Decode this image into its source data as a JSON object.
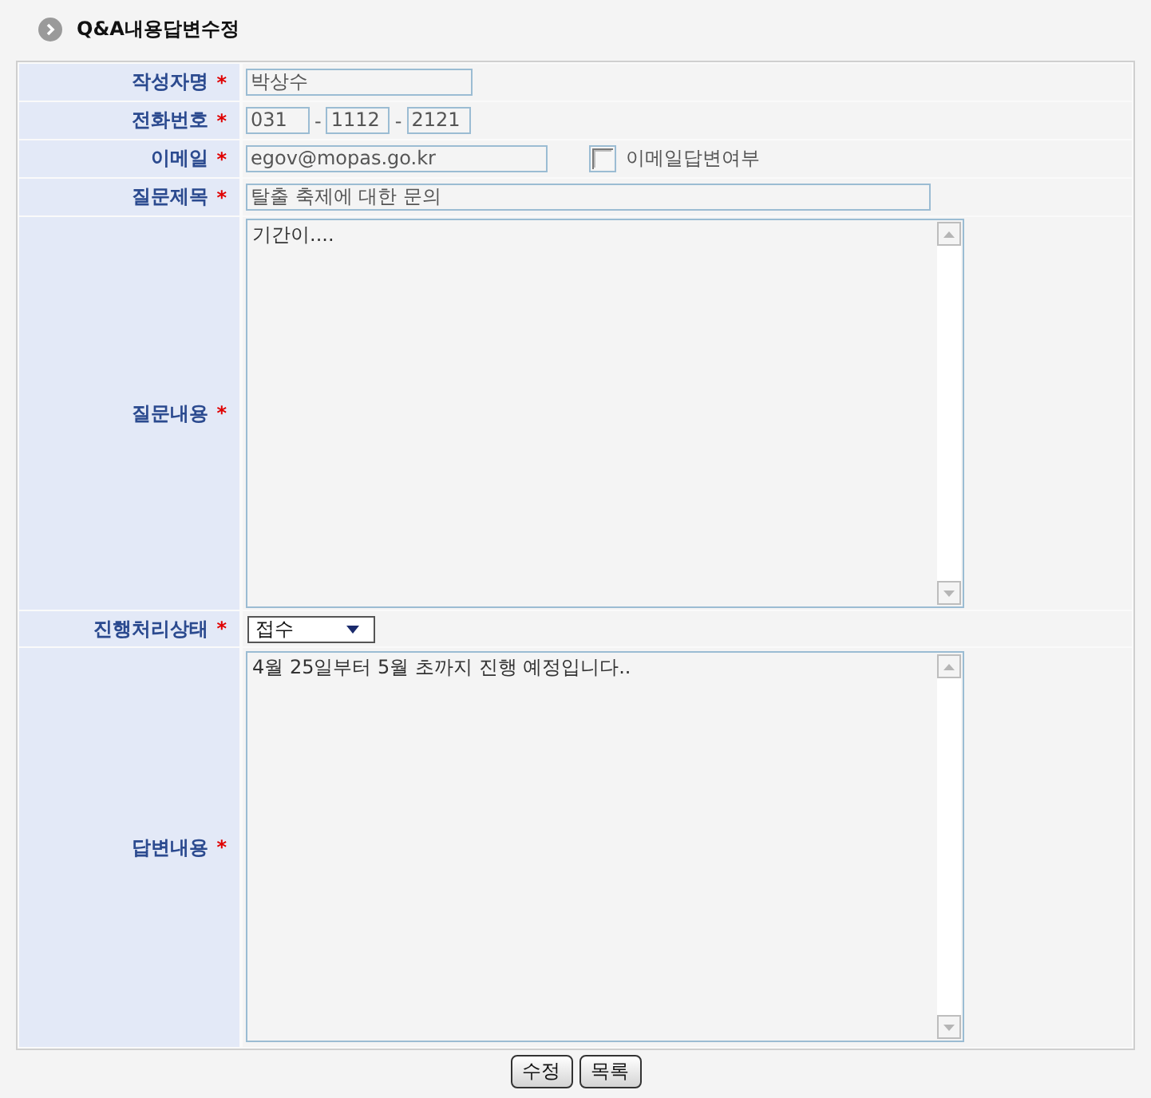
{
  "page": {
    "title": "Q&A내용답변수정"
  },
  "form": {
    "fields": [
      {
        "kind": "short",
        "label": "작성자명",
        "mark": "*",
        "value": "박상수"
      },
      {
        "kind": "phone",
        "label": "전화번호",
        "mark": "*",
        "parts": [
          {
            "value": "031"
          },
          {
            "separator": "-",
            "value": "1112"
          },
          {
            "separator": "-",
            "value": "2121"
          }
        ]
      },
      {
        "kind": "email",
        "label": "이메일",
        "mark": "*",
        "value": "egov@mopas.go.kr",
        "checkbox": {
          "label": "이메일답변여부",
          "checked": false
        }
      },
      {
        "kind": "long",
        "label": "질문제목",
        "mark": "*",
        "value": "탈출 축제에 대한 문의"
      },
      {
        "kind": "textarea",
        "label": "질문내용",
        "mark": "*",
        "value": "기간이...."
      },
      {
        "kind": "select",
        "label": "진행처리상태",
        "mark": "*",
        "value": "접수"
      },
      {
        "kind": "textarea",
        "label": "답변내용",
        "mark": "*",
        "value": "4월 25일부터 5월 초까지 진행 예정입니다.."
      }
    ]
  },
  "buttons": [
    {
      "label": "수정"
    },
    {
      "label": "목록"
    }
  ]
}
